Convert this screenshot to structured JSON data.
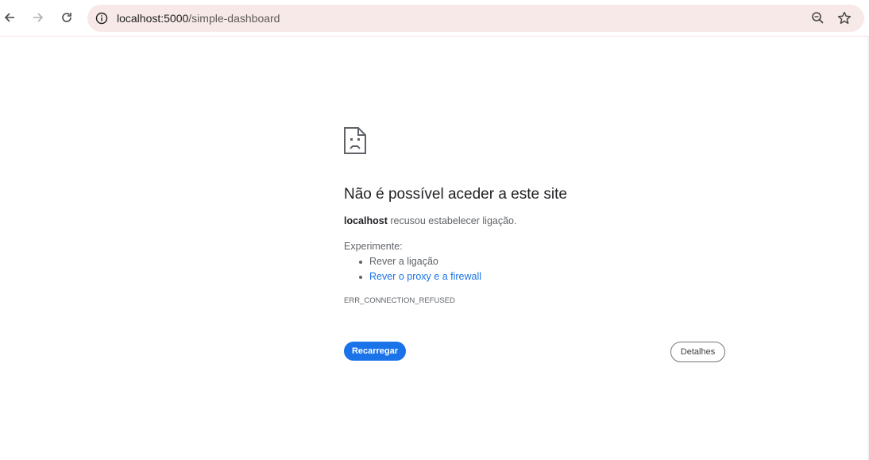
{
  "browser": {
    "url_host": "localhost:5000",
    "url_path": "/simple-dashboard",
    "icons": {
      "back": "arrow-left-icon",
      "forward": "arrow-right-icon",
      "reload": "reload-icon",
      "site_info": "info-icon",
      "zoom": "zoom-icon",
      "bookmark": "star-icon"
    }
  },
  "error_page": {
    "icon": "sad-page-icon",
    "title": "Não é possível aceder a este site",
    "host": "localhost",
    "message": " recusou estabelecer ligação.",
    "try_label": "Experimente:",
    "suggestions": [
      {
        "text": "Rever a ligação",
        "link": false
      },
      {
        "text": "Rever o proxy e a firewall",
        "link": true
      }
    ],
    "error_code": "ERR_CONNECTION_REFUSED",
    "reload_button": "Recarregar",
    "details_button": "Detalhes"
  },
  "colors": {
    "accent": "#1a73e8",
    "omnibox_bg": "#f6e9e7"
  }
}
